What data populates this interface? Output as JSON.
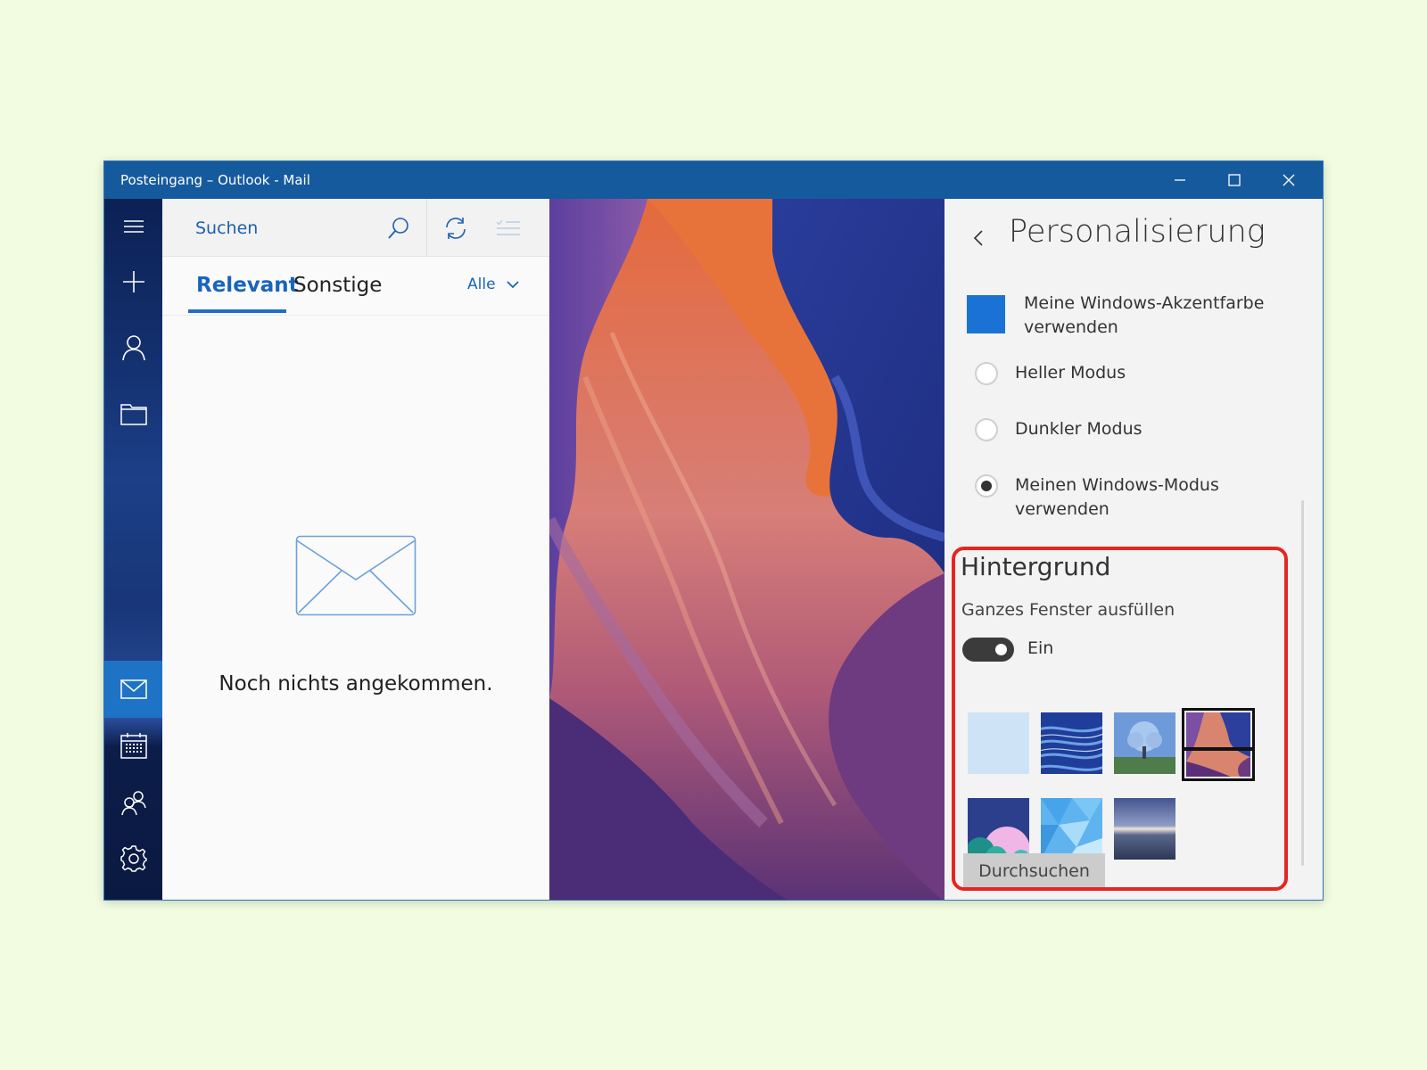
{
  "window": {
    "title": "Posteingang – Outlook - Mail",
    "controls": {
      "minimize": "minimize-icon",
      "maximize": "maximize-icon",
      "close": "close-icon"
    }
  },
  "nav": {
    "items": [
      {
        "name": "hamburger-menu-icon"
      },
      {
        "name": "new-mail-plus-icon"
      },
      {
        "name": "accounts-person-icon"
      },
      {
        "name": "folders-icon"
      },
      {
        "name": "mail-icon",
        "active": true
      },
      {
        "name": "calendar-icon"
      },
      {
        "name": "people-icon"
      },
      {
        "name": "settings-gear-icon"
      }
    ]
  },
  "list": {
    "search_placeholder": "Suchen",
    "tabs": [
      {
        "label": "Relevant",
        "active": true
      },
      {
        "label": "Sonstige",
        "active": false
      }
    ],
    "filter_label": "Alle",
    "empty_message": "Noch nichts angekommen."
  },
  "settings": {
    "title": "Personalisierung",
    "accent": {
      "label": "Meine Windows-Akzentfarbe verwenden",
      "color": "#1a73d4"
    },
    "modes": [
      {
        "label": "Heller Modus",
        "checked": false
      },
      {
        "label": "Dunkler Modus",
        "checked": false
      },
      {
        "label": "Meinen Windows-Modus verwenden",
        "checked": true
      }
    ],
    "background": {
      "heading": "Hintergrund",
      "fill_label": "Ganzes Fenster ausfüllen",
      "toggle_state": "Ein",
      "toggle_on": true,
      "thumbnails": [
        {
          "name": "light-blue-background",
          "selected": false
        },
        {
          "name": "blue-streaks-background",
          "selected": false
        },
        {
          "name": "tree-background",
          "selected": false
        },
        {
          "name": "canyon-background",
          "selected": true
        },
        {
          "name": "abstract-bubbles-background",
          "selected": false
        },
        {
          "name": "blue-polygons-background",
          "selected": false
        },
        {
          "name": "lake-sunset-background",
          "selected": false
        }
      ],
      "browse_label": "Durchsuchen"
    }
  },
  "colors": {
    "titlebar": "#165a9e",
    "accent": "#1a73d4",
    "highlight": "#e52521"
  }
}
